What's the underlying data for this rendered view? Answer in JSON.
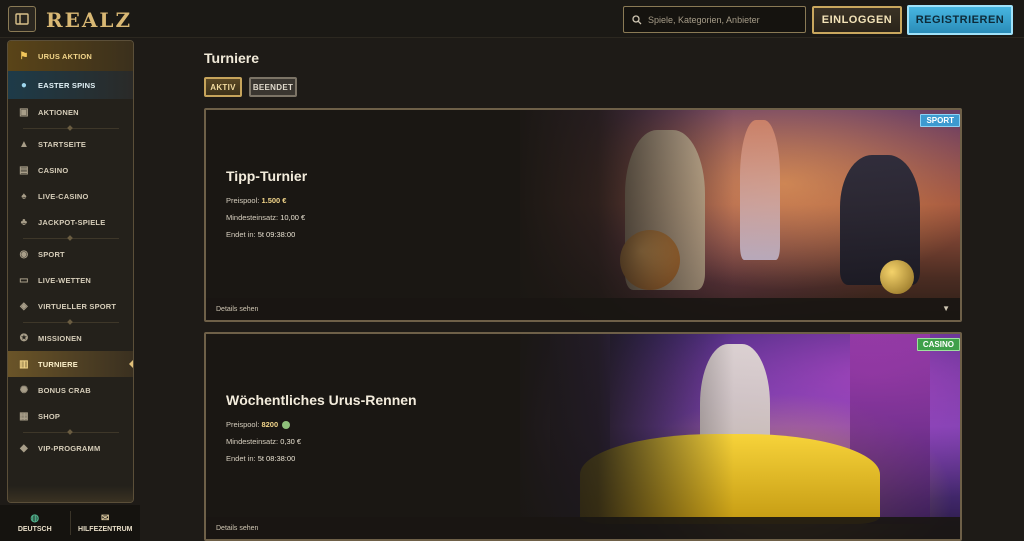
{
  "header": {
    "logo": "REALZ",
    "search_placeholder": "Spiele, Kategorien, Anbieter",
    "login_label": "EINLOGGEN",
    "register_label": "REGISTRIEREN"
  },
  "sidebar": {
    "items": [
      {
        "label": "URUS AKTION",
        "icon": "car-icon"
      },
      {
        "label": "EASTER SPINS",
        "icon": "egg-icon"
      },
      {
        "label": "AKTIONEN",
        "icon": "gift-icon"
      },
      {
        "label": "STARTSEITE",
        "icon": "pyramid-icon"
      },
      {
        "label": "CASINO",
        "icon": "slot-icon"
      },
      {
        "label": "LIVE-CASINO",
        "icon": "cards-icon"
      },
      {
        "label": "JACKPOT-SPIELE",
        "icon": "clover-icon"
      },
      {
        "label": "SPORT",
        "icon": "ball-icon"
      },
      {
        "label": "LIVE-WETTEN",
        "icon": "live-icon"
      },
      {
        "label": "VIRTUELLER SPORT",
        "icon": "virtual-icon"
      },
      {
        "label": "MISSIONEN",
        "icon": "mission-icon"
      },
      {
        "label": "TURNIERE",
        "icon": "trophy-icon"
      },
      {
        "label": "BONUS CRAB",
        "icon": "crab-icon"
      },
      {
        "label": "SHOP",
        "icon": "shop-icon"
      },
      {
        "label": "VIP-PROGRAMM",
        "icon": "diamond-icon"
      }
    ]
  },
  "footer": {
    "language_label": "DEUTSCH",
    "help_label": "HILFEZENTRUM"
  },
  "main": {
    "title": "Turniere",
    "tabs": [
      {
        "label": "AKTIV"
      },
      {
        "label": "BEENDET"
      }
    ],
    "tournaments": [
      {
        "badge": "SPORT",
        "title": "Tipp-Turnier",
        "prize_label": "Preispool:",
        "prize_value": "1.500 €",
        "min_label": "Mindesteinsatz:",
        "min_value": "10,00 €",
        "ends_label": "Endet in:",
        "ends_value": "5t 09:38:00",
        "details_label": "Details sehen"
      },
      {
        "badge": "CASINO",
        "title": "Wöchentliches Urus-Rennen",
        "prize_label": "Preispool:",
        "prize_value": "8200",
        "min_label": "Mindesteinsatz:",
        "min_value": "0,30 €",
        "ends_label": "Endet in:",
        "ends_value": "5t 08:38:00",
        "details_label": "Details sehen"
      }
    ]
  },
  "colors": {
    "accent_gold": "#c9a75e",
    "register_blue": "#47b6e1",
    "sport_badge": "#3d9ad0",
    "casino_badge": "#3fa04a"
  }
}
